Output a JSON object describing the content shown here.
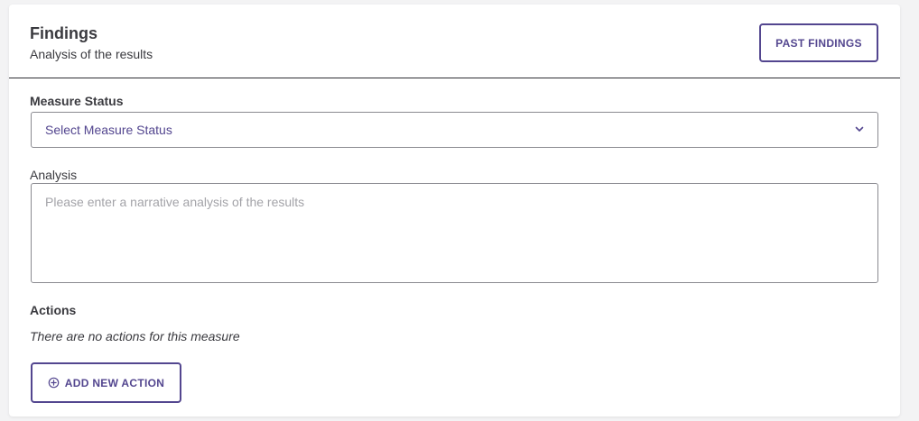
{
  "findings": {
    "title": "Findings",
    "subtitle": "Analysis of the results",
    "past_findings_label": "PAST FINDINGS"
  },
  "measure_status": {
    "label": "Measure Status",
    "selected_value": "Select Measure Status"
  },
  "analysis": {
    "label": "Analysis",
    "value": "",
    "placeholder": "Please enter a narrative analysis of the results"
  },
  "actions": {
    "label": "Actions",
    "empty_message": "There are no actions for this measure",
    "add_label": "ADD NEW ACTION"
  },
  "icons": {
    "select_chevron": "chevron-down-icon",
    "add_action": "plus-circle-icon"
  },
  "colors": {
    "accent": "#53468f",
    "text": "#3a3a3f",
    "border": "#8a8a90",
    "placeholder": "#a3a3a8"
  }
}
